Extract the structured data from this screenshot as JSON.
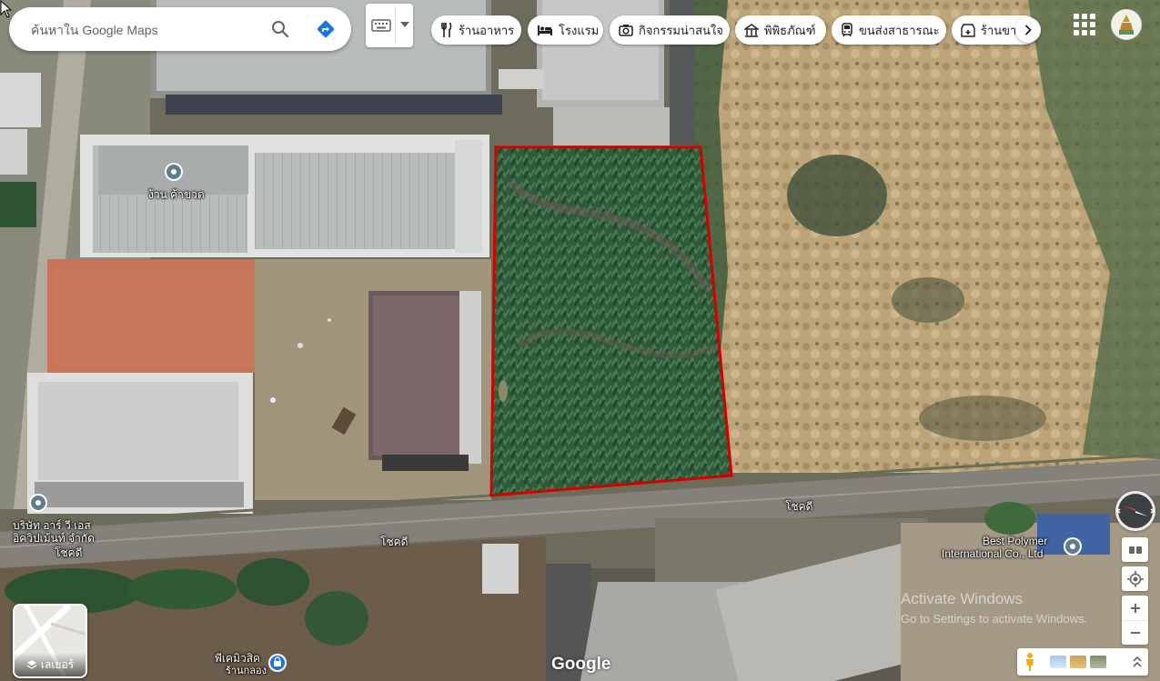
{
  "search": {
    "placeholder": "ค้นหาใน Google Maps"
  },
  "chips": [
    {
      "label": "ร้านอาหาร",
      "icon": "fork-knife-icon"
    },
    {
      "label": "โรงแรม",
      "icon": "bed-icon"
    },
    {
      "label": "กิจกรรมน่าสนใจ",
      "icon": "camera-icon"
    },
    {
      "label": "พิพิธภัณฑ์",
      "icon": "museum-icon"
    },
    {
      "label": "ขนส่งสาธารณะ",
      "icon": "transit-icon"
    },
    {
      "label": "ร้านขายยา",
      "icon": "pharmacy-icon"
    }
  ],
  "map_labels": {
    "place1": "ง้วน ค้าขวด",
    "place2_line1": "บริษัท อาร์ วี เอส",
    "place2_line2": "อิควิปเม้นท์ จำกัด",
    "road_left": "โชคดี",
    "road_mid": "โชคดี",
    "road_right": "โชคดี",
    "place3_line1": "Best Polymer",
    "place3_line2": "International Co., Ltd",
    "place4_line1": "พีเคมิวสิค",
    "place4_line2": "ร้านกลอง"
  },
  "layers": {
    "label": "เลเยอร์"
  },
  "branding": {
    "logo": "Google"
  },
  "watermark": {
    "line1": "Activate Windows",
    "line2": "Go to Settings to activate Windows."
  },
  "colors": {
    "highlight": "#d40000",
    "chip_text": "#202124",
    "direction_blue": "#1a73e8"
  }
}
